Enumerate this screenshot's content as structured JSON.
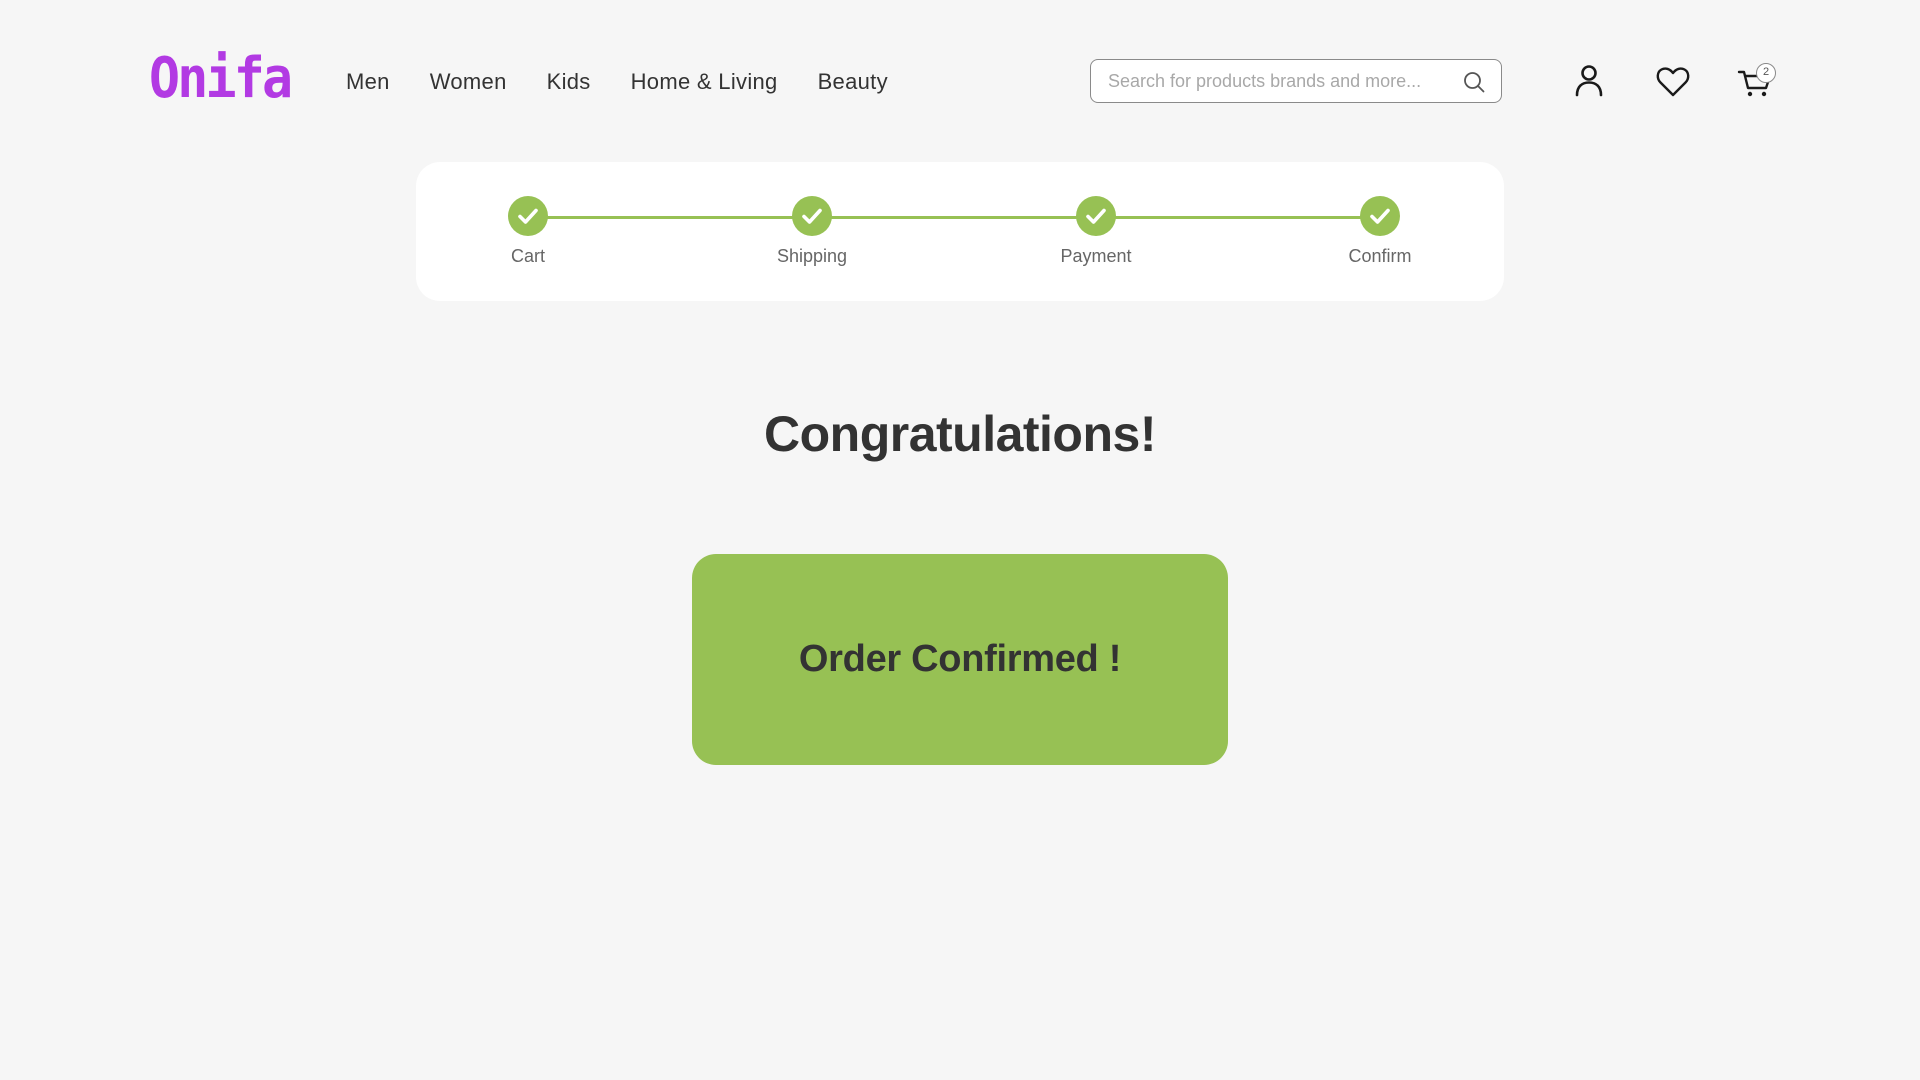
{
  "colors": {
    "brand": "#b23ae3",
    "accent_green": "#97c154",
    "background": "#f6f6f6",
    "text": "#333333"
  },
  "header": {
    "logo": "Onifa",
    "nav": [
      {
        "label": "Men"
      },
      {
        "label": "Women"
      },
      {
        "label": "Kids"
      },
      {
        "label": "Home & Living"
      },
      {
        "label": "Beauty"
      }
    ],
    "search": {
      "placeholder": "Search for products brands and more...",
      "value": "",
      "icon": "search-icon"
    },
    "icons": {
      "user": "user-icon",
      "wishlist": "heart-icon",
      "cart": "cart-icon"
    },
    "cart_count": "2"
  },
  "stepper": {
    "steps": [
      {
        "label": "Cart",
        "completed": true
      },
      {
        "label": "Shipping",
        "completed": true
      },
      {
        "label": "Payment",
        "completed": true
      },
      {
        "label": "Confirm",
        "completed": true
      }
    ]
  },
  "main": {
    "title": "Congratulations!",
    "confirmation": "Order Confirmed !"
  }
}
